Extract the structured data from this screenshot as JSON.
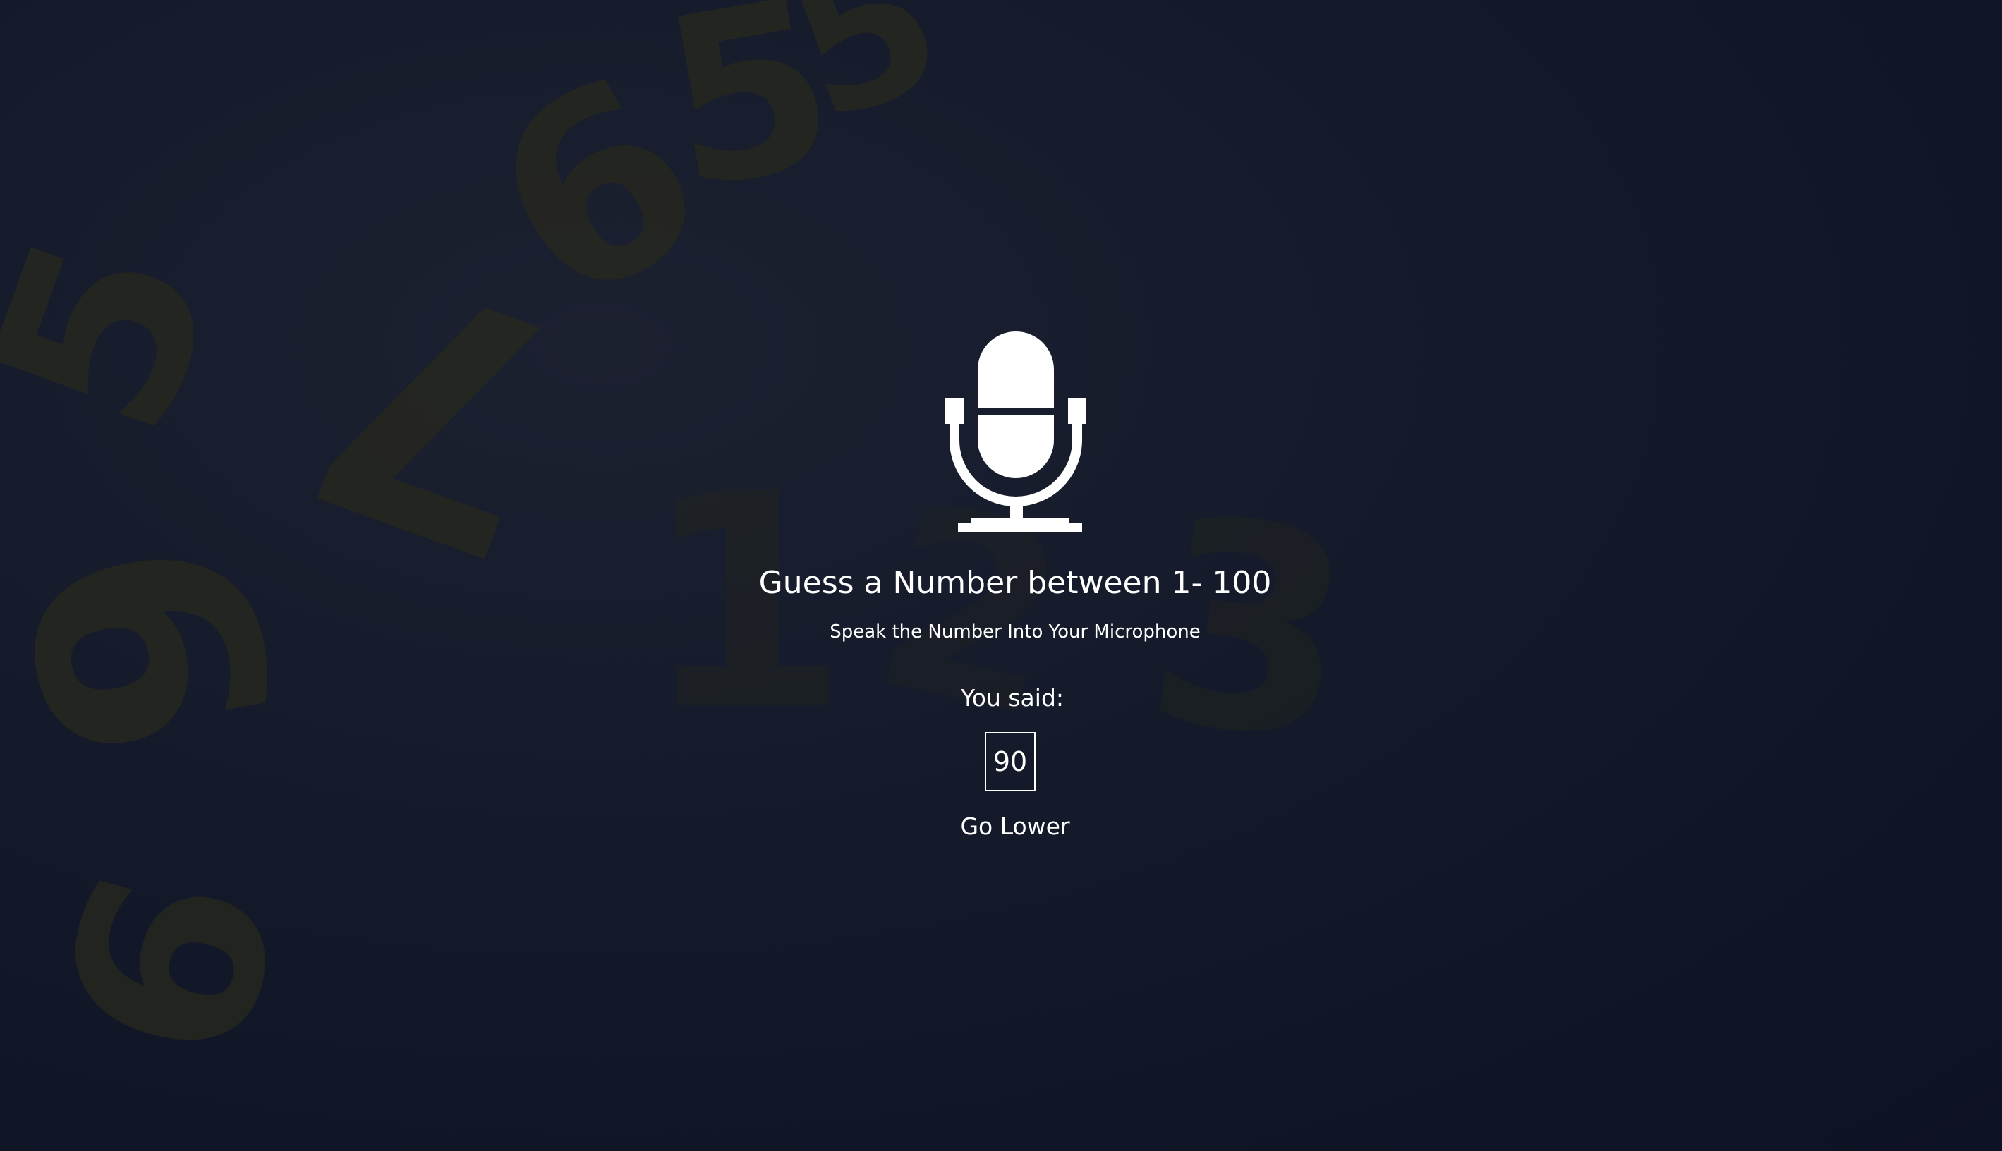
{
  "icons": {
    "microphone": "microphone-icon"
  },
  "game": {
    "title": "Guess a Number between 1- 100",
    "instruction": "Speak the Number Into Your Microphone",
    "you_said_label": "You said:",
    "spoken_value": "90",
    "feedback": "Go Lower"
  },
  "background": {
    "digits": [
      "1",
      "2",
      "3",
      "5",
      "6",
      "7",
      "9",
      "5",
      "6",
      "5"
    ]
  },
  "colors": {
    "background": "#121727",
    "text": "#ffffff",
    "digit_tint": "#2a2b22"
  }
}
